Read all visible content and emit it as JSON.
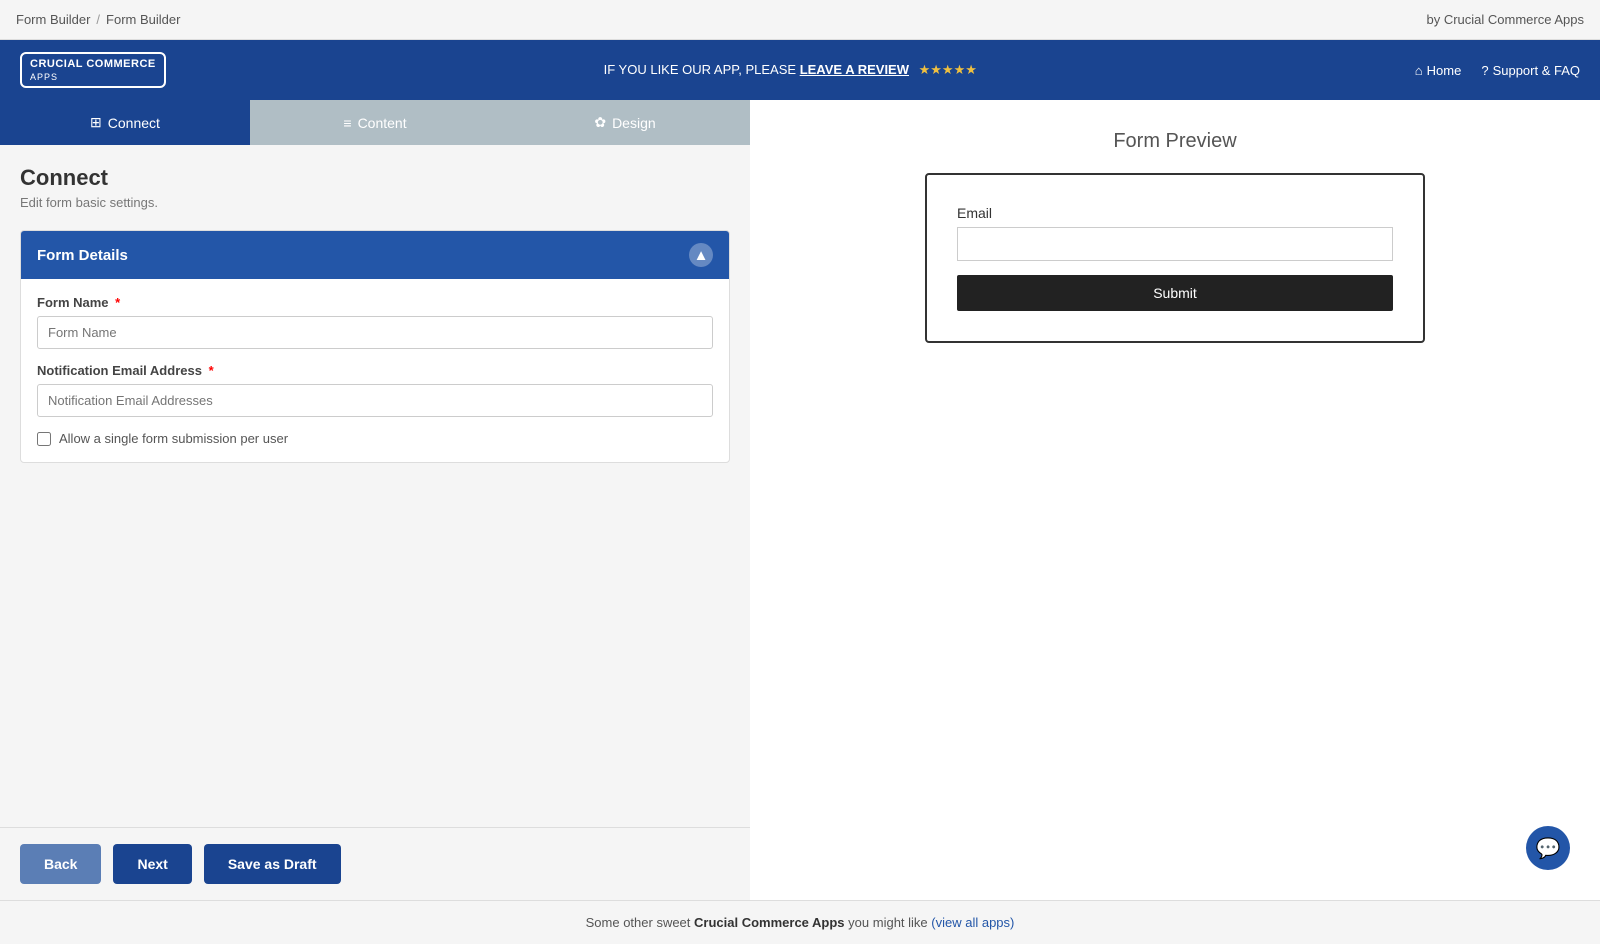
{
  "topbar": {
    "breadcrumb1": "Form Builder",
    "sep": "/",
    "breadcrumb2": "Form Builder",
    "right": "by Crucial Commerce Apps"
  },
  "logobar": {
    "logo_line1": "CRUCIAL COMMERCE",
    "logo_line2": "APPS",
    "promo_text": "IF YOU LIKE OUR APP, PLEASE",
    "promo_link": "LEAVE A REVIEW",
    "stars": "★★★★★",
    "nav_home": "Home",
    "nav_support": "Support & FAQ"
  },
  "tabs": [
    {
      "id": "connect",
      "label": "Connect",
      "icon": "⊞",
      "state": "active"
    },
    {
      "id": "content",
      "label": "Content",
      "icon": "≡",
      "state": "inactive"
    },
    {
      "id": "design",
      "label": "Design",
      "icon": "✿",
      "state": "inactive"
    }
  ],
  "section": {
    "title": "Connect",
    "subtitle": "Edit form basic settings."
  },
  "form_details": {
    "header": "Form Details",
    "form_name_label": "Form Name",
    "form_name_required": "*",
    "form_name_placeholder": "Form Name",
    "notification_label": "Notification Email Address",
    "notification_required": "*",
    "notification_placeholder": "Notification Email Addresses",
    "checkbox_label": "Allow a single form submission per user"
  },
  "buttons": {
    "back": "Back",
    "next": "Next",
    "save_draft": "Save as Draft"
  },
  "preview": {
    "title": "Form Preview",
    "email_label": "Email",
    "email_placeholder": "",
    "submit_label": "Submit"
  },
  "footer": {
    "text": "Some other sweet",
    "brand": "Crucial Commerce Apps",
    "mid": "you might like",
    "link_text": "(view all apps)",
    "link_href": "#"
  }
}
